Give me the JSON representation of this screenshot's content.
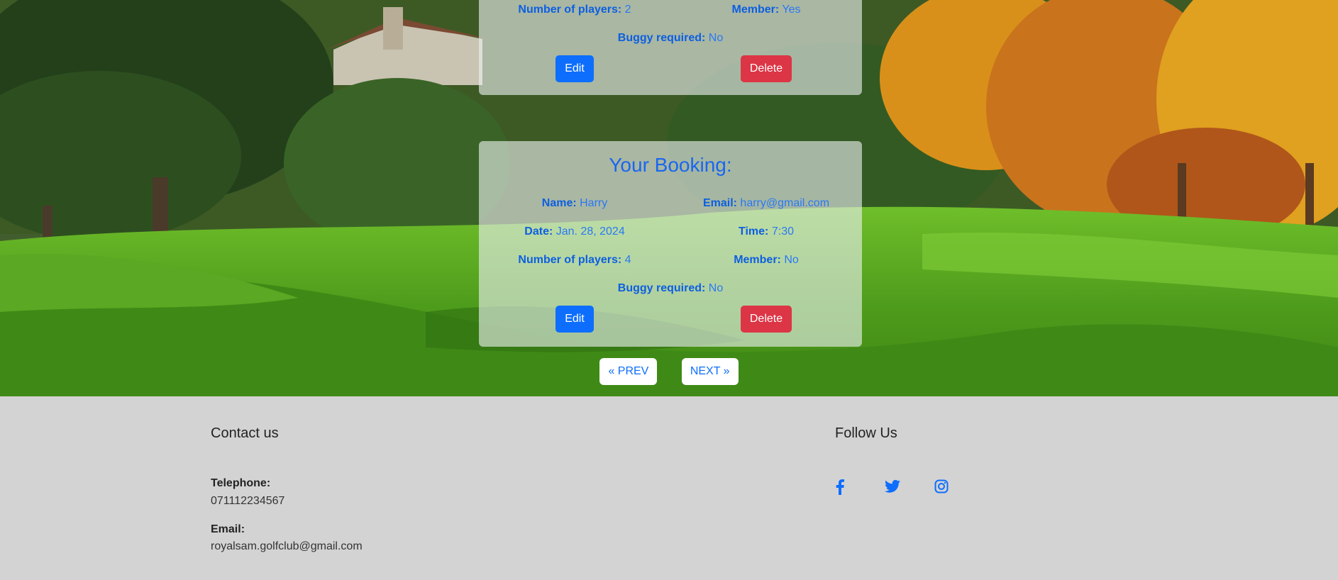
{
  "bookings": [
    {
      "title": "",
      "players_label": "Number of players:",
      "players": "2",
      "member_label": "Member:",
      "member": "Yes",
      "buggy_label": "Buggy required:",
      "buggy": "No",
      "edit_label": "Edit",
      "delete_label": "Delete"
    },
    {
      "title": "Your Booking:",
      "name_label": "Name:",
      "name": "Harry",
      "email_label": "Email:",
      "email": "harry@gmail.com",
      "date_label": "Date:",
      "date": "Jan. 28, 2024",
      "time_label": "Time:",
      "time": "7:30",
      "players_label": "Number of players:",
      "players": "4",
      "member_label": "Member:",
      "member": "No",
      "buggy_label": "Buggy required:",
      "buggy": "No",
      "edit_label": "Edit",
      "delete_label": "Delete"
    }
  ],
  "pagination": {
    "prev_label": "« PREV",
    "next_label": "NEXT »"
  },
  "footer": {
    "contact_heading": "Contact us",
    "telephone_label": "Telephone:",
    "telephone": "071112234567",
    "email_label": "Email:",
    "email": "royalsam.golfclub@gmail.com",
    "follow_heading": "Follow Us",
    "social_icons": [
      "facebook-icon",
      "twitter-icon",
      "instagram-icon"
    ]
  },
  "colors": {
    "primary": "#0d6efd",
    "danger": "#dc3545",
    "footer_bg": "#d3d3d3"
  }
}
